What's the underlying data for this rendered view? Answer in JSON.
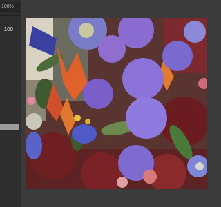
{
  "panel": {
    "zoom_label": "100%",
    "value": "100"
  },
  "canvas": {
    "image_subject": "flower-bouquet-photo"
  }
}
